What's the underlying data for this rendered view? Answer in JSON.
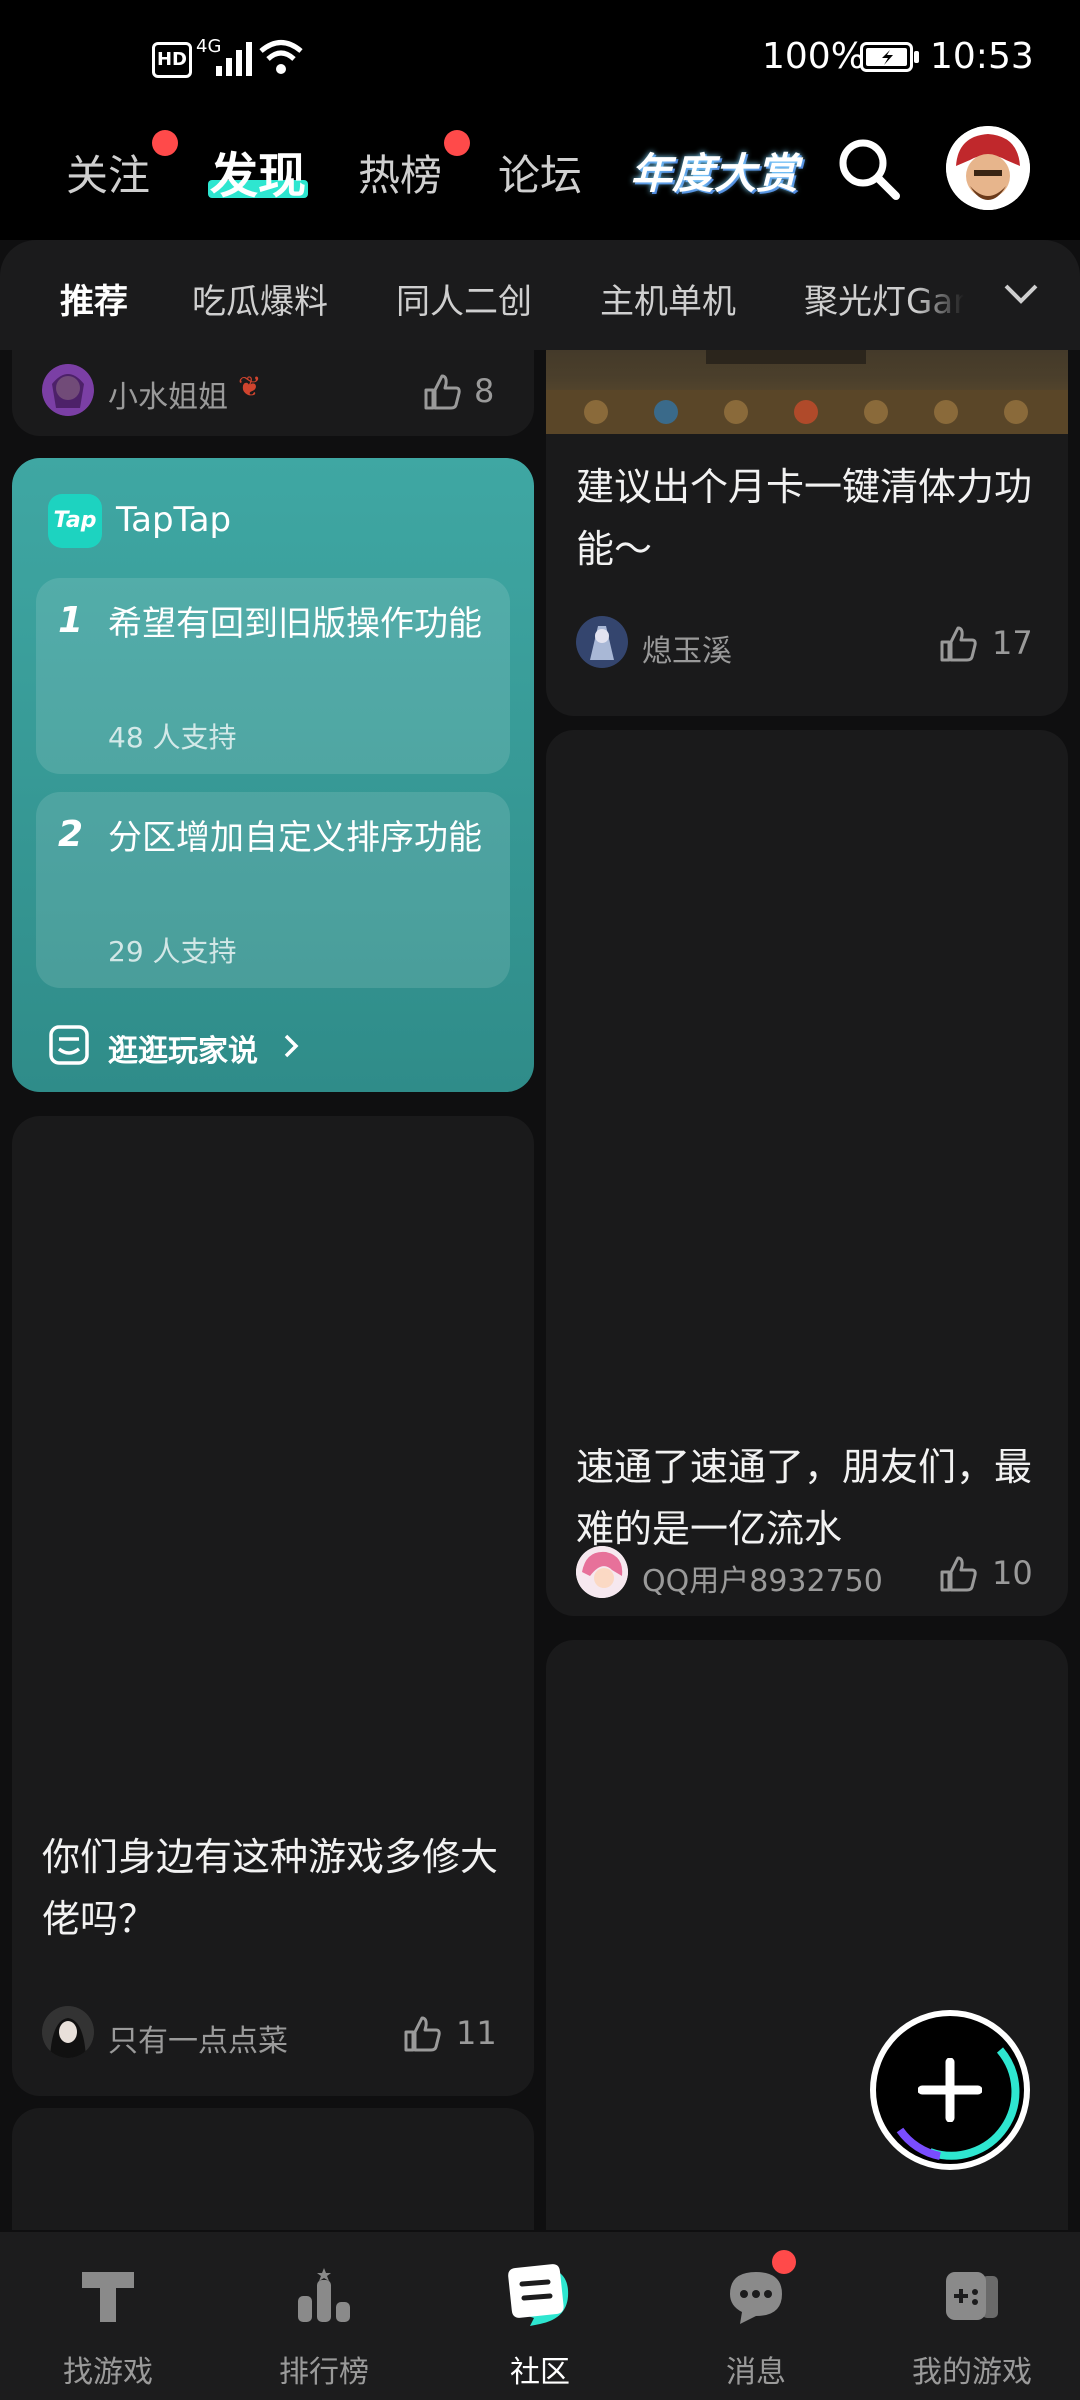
{
  "status_bar": {
    "hd": "HD",
    "network": "4G",
    "battery": "100%",
    "time": "10:53"
  },
  "header": {
    "tabs": [
      {
        "label": "关注",
        "dot": true
      },
      {
        "label": "发现",
        "active": true
      },
      {
        "label": "热榜",
        "dot": true
      },
      {
        "label": "论坛"
      }
    ],
    "event_banner": "年度大赏",
    "icons": [
      "search-icon",
      "profile-avatar"
    ]
  },
  "categories": {
    "items": [
      "推荐",
      "吃瓜爆料",
      "同人二创",
      "主机单机",
      "聚光灯Gam"
    ],
    "active": "推荐",
    "expand_icon": "chevron-down-icon"
  },
  "feed": {
    "left": {
      "top_meta": {
        "author": "小水姐姐",
        "likes": "8"
      },
      "taptap_card": {
        "brand": "TapTap",
        "badge_icon": "Tap",
        "items": [
          {
            "rank": "1",
            "title": "希望有回到旧版操作功能",
            "support": "48 人支持"
          },
          {
            "rank": "2",
            "title": "分区增加自定义排序功能",
            "support": "29 人支持"
          }
        ],
        "footer": "逛逛玩家说"
      },
      "post": {
        "title": "你们身边有这种游戏多修大佬吗？",
        "author": "只有一点点菜",
        "likes": "11"
      }
    },
    "right": {
      "post1": {
        "title": "建议出个月卡一键清体力功能～",
        "author": "熄玉溪",
        "likes": "17"
      },
      "post2": {
        "title": "速通了速通了，朋友们，最难的是一亿流水",
        "author": "QQ用户8932750",
        "likes": "10"
      }
    }
  },
  "fab": {
    "icon": "plus-icon"
  },
  "bottom_nav": {
    "items": [
      {
        "label": "找游戏",
        "icon": "find-games-icon"
      },
      {
        "label": "排行榜",
        "icon": "ranking-icon"
      },
      {
        "label": "社区",
        "icon": "community-icon",
        "active": true
      },
      {
        "label": "消息",
        "icon": "message-icon",
        "dot": true
      },
      {
        "label": "我的游戏",
        "icon": "my-games-icon"
      }
    ]
  },
  "colors": {
    "background": "#0f0f10",
    "card": "#1a1a1b",
    "taptap_teal": "#3fa7a3",
    "red_dot": "#ff4a4a",
    "accent_cyan": "#2ee6d0"
  }
}
